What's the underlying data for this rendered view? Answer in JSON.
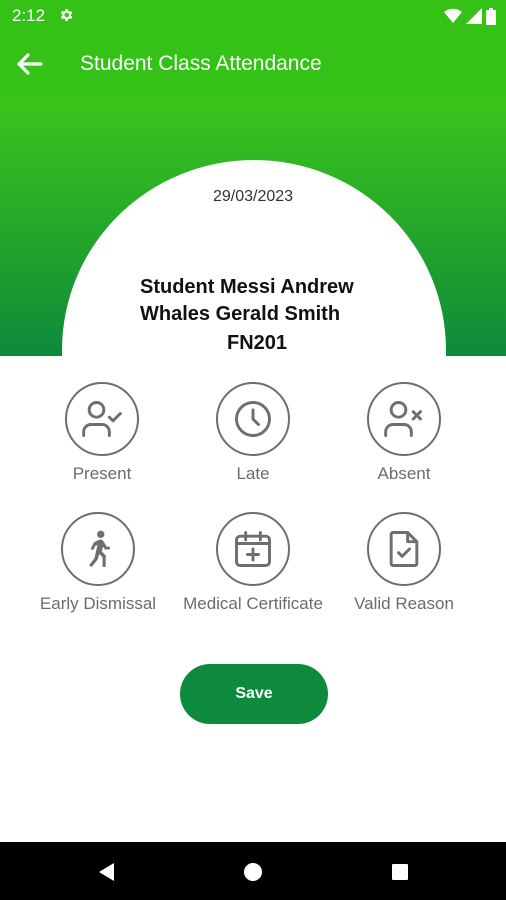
{
  "status_bar": {
    "time": "2:12"
  },
  "app_bar": {
    "title": "Student Class Attendance"
  },
  "record": {
    "date": "29/03/2023",
    "student_name": "Student Messi Andrew Whales Gerald Smith",
    "class_code": "FN201"
  },
  "options": [
    {
      "label": "Present",
      "icon": "person-check-icon"
    },
    {
      "label": "Late",
      "icon": "clock-icon"
    },
    {
      "label": "Absent",
      "icon": "person-x-icon"
    },
    {
      "label": "Early Dismissal",
      "icon": "walking-person-icon"
    },
    {
      "label": "Medical Certificate",
      "icon": "calendar-plus-icon"
    },
    {
      "label": "Valid Reason",
      "icon": "document-check-icon"
    }
  ],
  "actions": {
    "save_label": "Save"
  },
  "colors": {
    "primary_green": "#35c217",
    "dark_green": "#0d8a3c",
    "icon_gray": "#6e6e6e"
  }
}
